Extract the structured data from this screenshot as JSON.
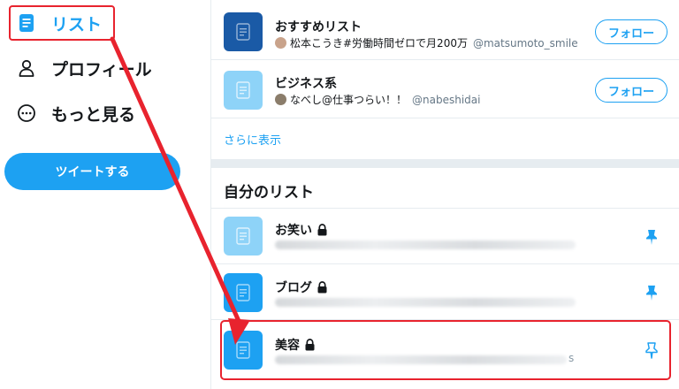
{
  "sidebar": {
    "items": [
      {
        "label": "リスト",
        "icon": "list-icon",
        "active": true
      },
      {
        "label": "プロフィール",
        "icon": "person-icon",
        "active": false
      },
      {
        "label": "もっと見る",
        "icon": "more-circle-icon",
        "active": false
      }
    ],
    "tweet_button": "ツイートする"
  },
  "suggested_lists": [
    {
      "name": "おすすめリスト",
      "owner_name": "松本こうき#労働時間ゼロで月200万",
      "owner_handle": "@matsumoto_smile",
      "follow_label": "フォロー",
      "thumb": "dark"
    },
    {
      "name": "ビジネス系",
      "owner_name": "なべし@仕事つらい！！",
      "owner_handle": "@nabeshidai",
      "follow_label": "フォロー",
      "thumb": "light"
    }
  ],
  "show_more": "さらに表示",
  "my_lists": {
    "title": "自分のリスト",
    "items": [
      {
        "name": "お笑い",
        "locked": true,
        "pinned": true,
        "thumb": "light"
      },
      {
        "name": "ブログ",
        "locked": true,
        "pinned": true,
        "thumb": "mid"
      },
      {
        "name": "美容",
        "locked": true,
        "pinned": false,
        "thumb": "mid",
        "blur_tail": "s"
      }
    ]
  },
  "colors": {
    "accent": "#1da1f2",
    "annotation": "#e8232e",
    "divider": "#e6ecf0"
  }
}
